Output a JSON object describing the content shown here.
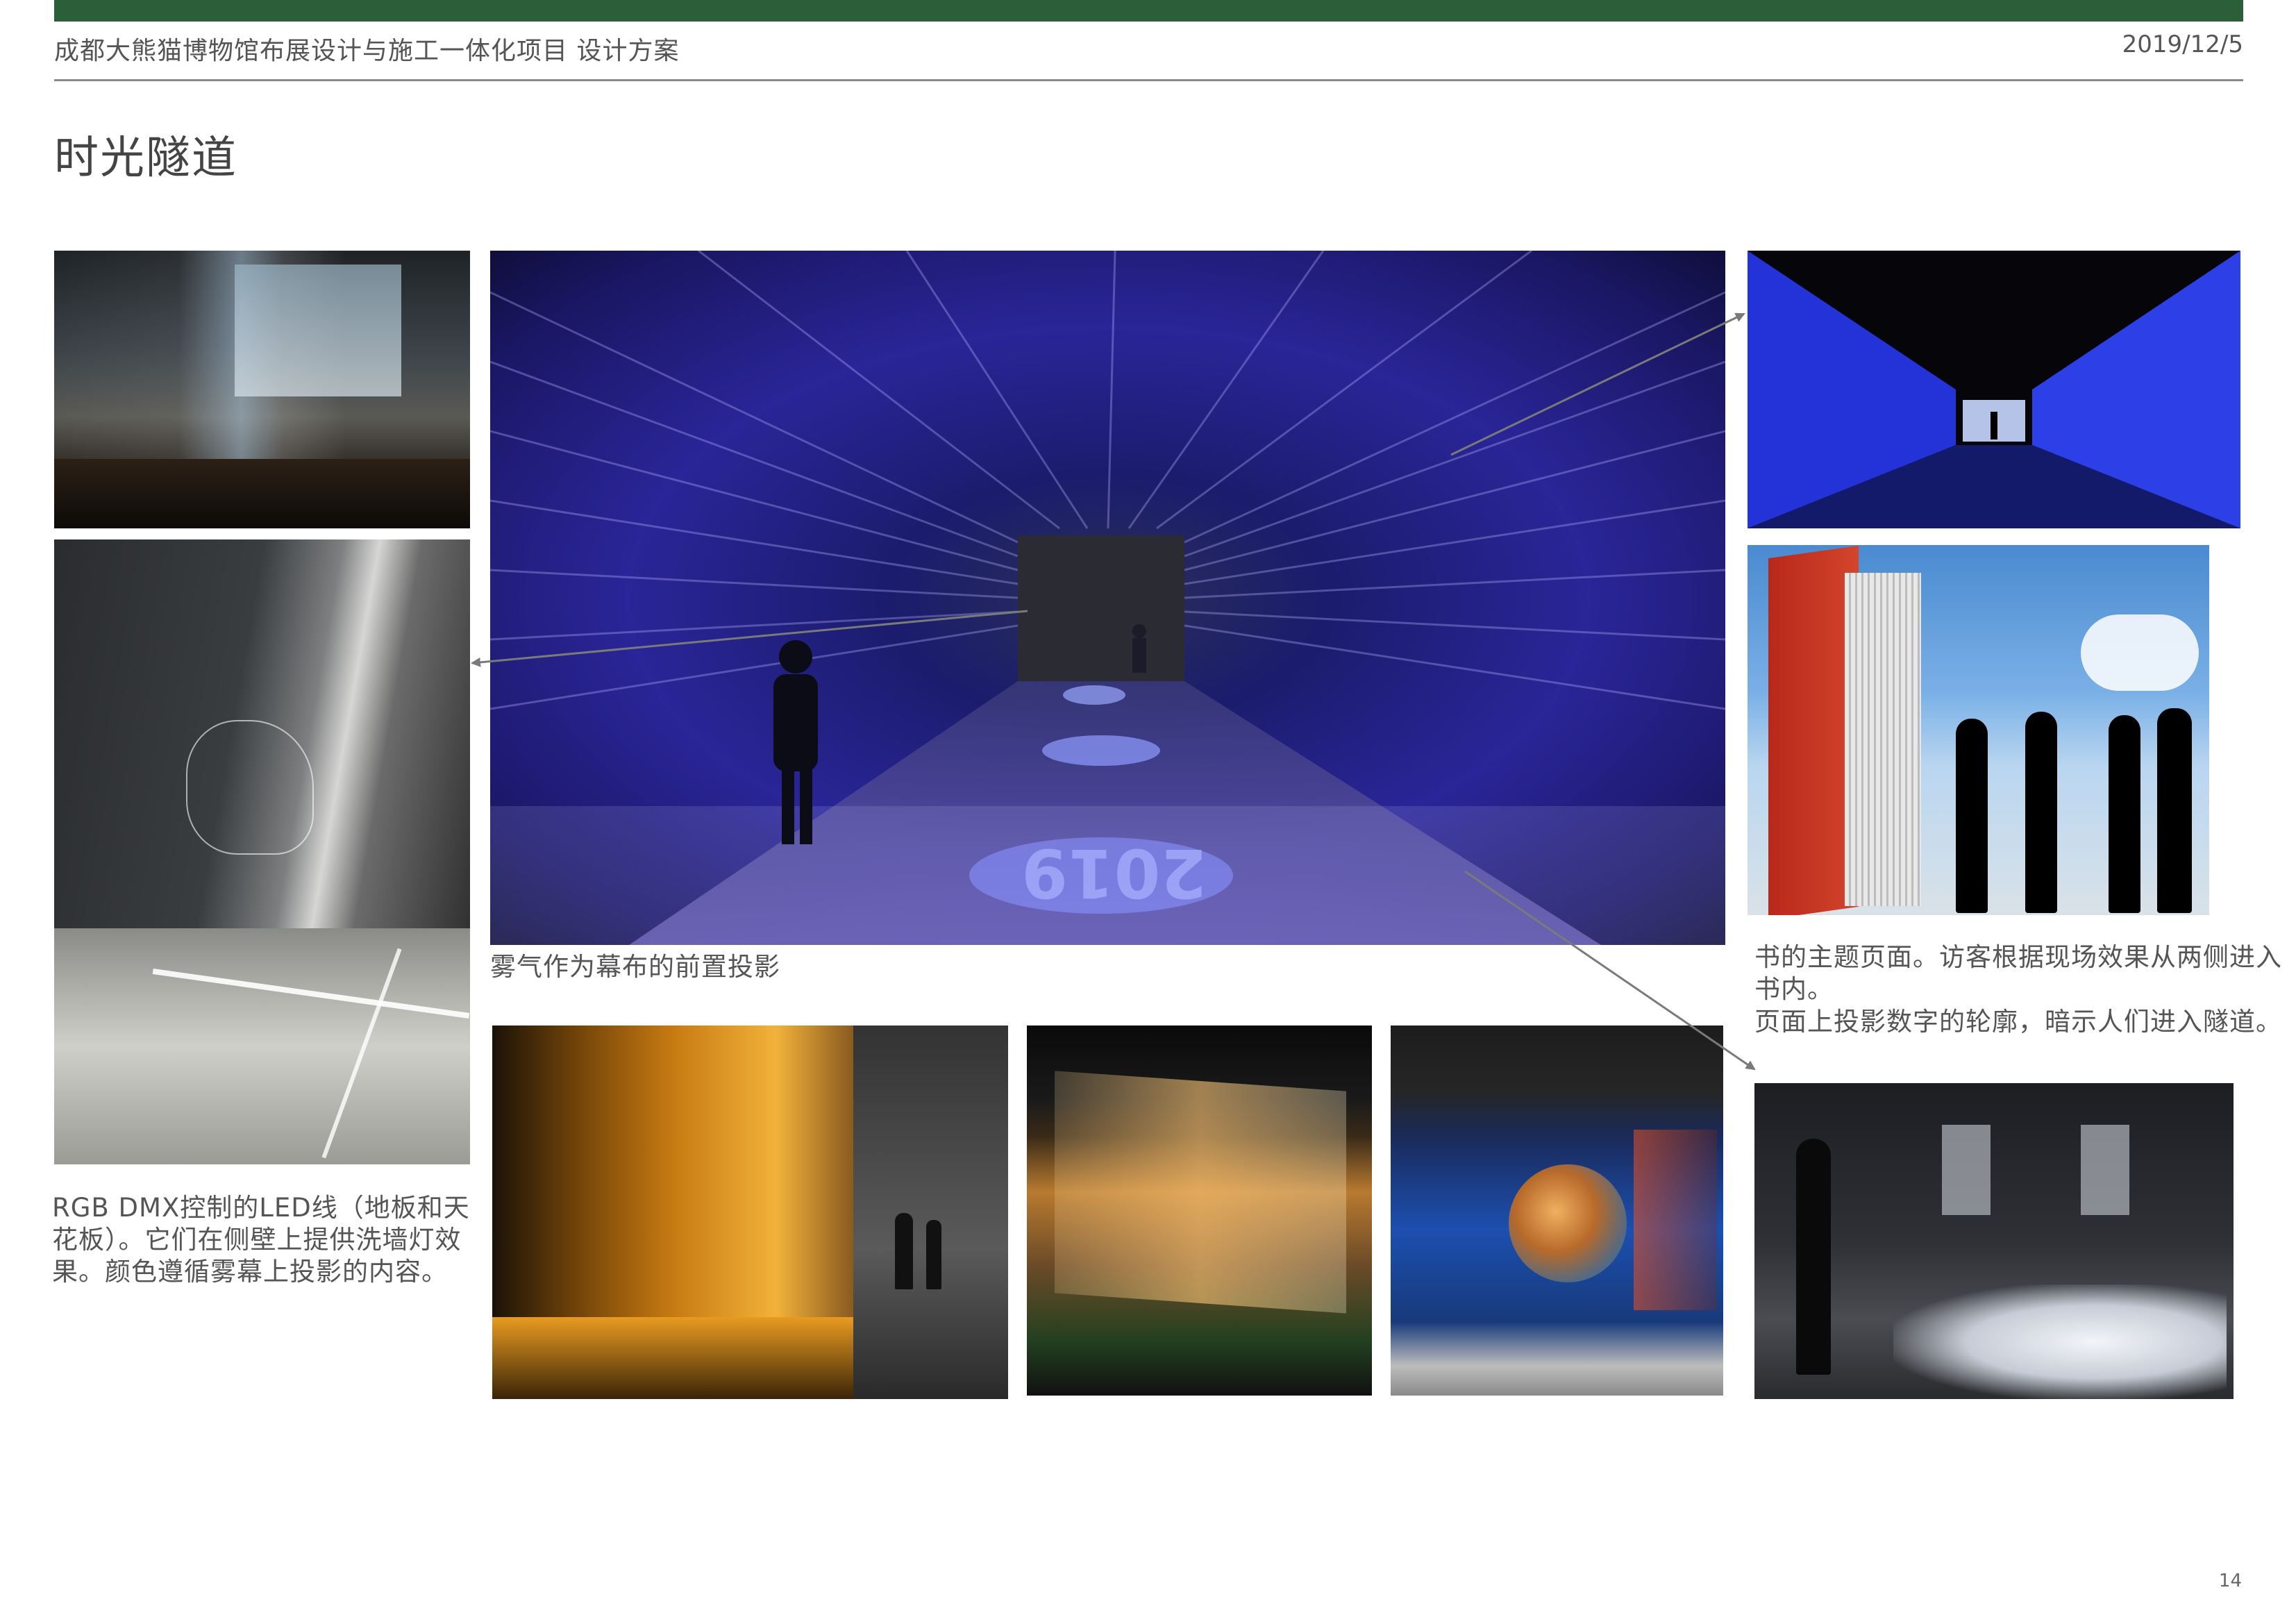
{
  "header": {
    "title": "成都大熊猫博物馆布展设计与施工一体化项目  设计方案",
    "date": "2019/12/5"
  },
  "page_title": "时光隧道",
  "captions": {
    "main_tunnel": "雾气作为幕布的前置投影",
    "led_line": "RGB DMX控制的LED线（地板和天花板）。它们在侧壁上提供洗墙灯效果。颜色遵循雾幕上投影的内容。",
    "book_pages": "书的主题页面。访客根据现场效果从两侧进入书内。",
    "digit_outline": "页面上投影数字的轮廓，暗示人们进入隧道。"
  },
  "image_text": {
    "floor_projection": "2019"
  },
  "page_number": "14",
  "colors": {
    "top_bar": "#2a5f3a",
    "rule": "#8a8a8a",
    "arrow": "#7a7a7a"
  }
}
